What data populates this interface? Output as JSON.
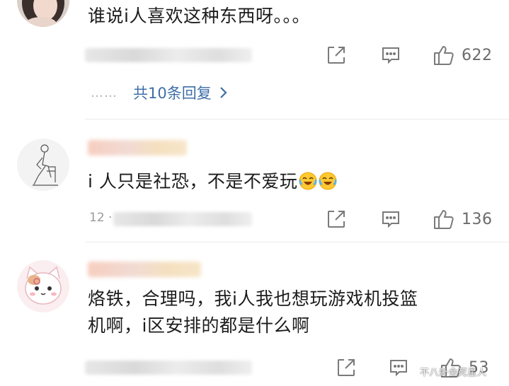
{
  "comments": [
    {
      "text_lines": [
        "谁说i人喜欢这种东西呀。。。"
      ],
      "likes": "622",
      "replies_label": "共10条回复",
      "replies_dots": "……"
    },
    {
      "text_lines": [
        "i 人只是社恐，不是不爱玩"
      ],
      "emoji": [
        "laughing-crying-emoji",
        "laughing-crying-emoji"
      ],
      "meta_fragment": "12 ·",
      "likes": "136"
    },
    {
      "text_lines": [
        "烙铁，合理吗，我i人我也想玩游戏机投篮",
        "机啊，i区安排的都是什么啊"
      ],
      "likes": "53"
    }
  ],
  "icons": {
    "share": "share-icon",
    "comment": "comment-icon",
    "like": "thumbs-up-icon",
    "more_replies": "chevron-right-icon"
  },
  "colors": {
    "link": "#3e6ea8",
    "icon": "#7a7a7a",
    "text": "#1c1c1c"
  },
  "watermark": "不八卦会死星人"
}
